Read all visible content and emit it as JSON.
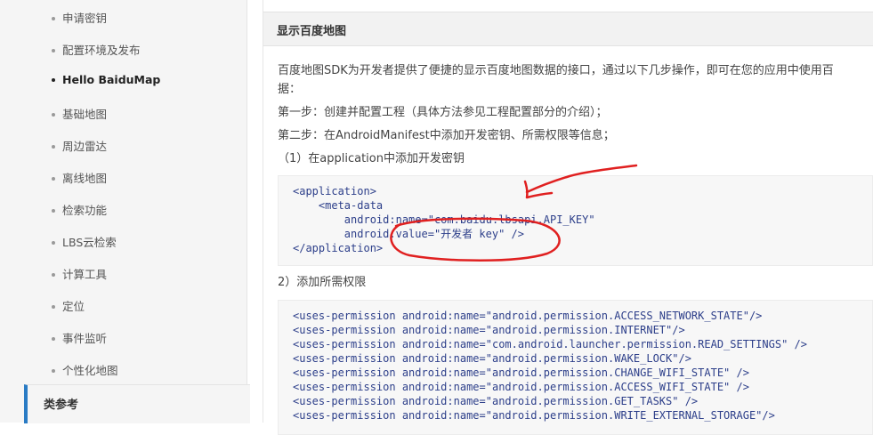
{
  "sidebar": {
    "items": [
      {
        "label": "申请密钥"
      },
      {
        "label": "配置环境及发布"
      },
      {
        "label": "Hello BaiduMap"
      },
      {
        "label": "基础地图"
      },
      {
        "label": "周边雷达"
      },
      {
        "label": "离线地图"
      },
      {
        "label": "检索功能"
      },
      {
        "label": "LBS云检索"
      },
      {
        "label": "计算工具"
      },
      {
        "label": "定位"
      },
      {
        "label": "事件监听"
      },
      {
        "label": "个性化地图"
      }
    ],
    "section": "类参考"
  },
  "main": {
    "title": "显示百度地图",
    "intro_line1": "百度地图SDK为开发者提供了便捷的显示百度地图数据的接口，通过以下几步操作，即可在您的应用中使用百",
    "intro_line2": "据：",
    "step1": "第一步：创建并配置工程（具体方法参见工程配置部分的介绍）；",
    "step2": "第二步：在AndroidManifest中添加开发密钥、所需权限等信息；",
    "step2_sub1": "（1）在application中添加开发密钥",
    "code1": [
      "<application>",
      "    <meta-data",
      "        android:name=\"com.baidu.lbsapi.API_KEY\"",
      "        android:value=\"开发者 key\" />",
      "</application>"
    ],
    "step2_sub2": "2）添加所需权限",
    "code2": [
      "<uses-permission android:name=\"android.permission.ACCESS_NETWORK_STATE\"/>",
      "<uses-permission android:name=\"android.permission.INTERNET\"/>",
      "<uses-permission android:name=\"com.android.launcher.permission.READ_SETTINGS\" />",
      "<uses-permission android:name=\"android.permission.WAKE_LOCK\"/>",
      "<uses-permission android:name=\"android.permission.CHANGE_WIFI_STATE\" />",
      "<uses-permission android:name=\"android.permission.ACCESS_WIFI_STATE\" />",
      "<uses-permission android:name=\"android.permission.GET_TASKS\" />",
      "<uses-permission android:name=\"android.permission.WRITE_EXTERNAL_STORAGE\"/>"
    ]
  },
  "colors": {
    "accent": "#2a7bc4",
    "annotation_red": "#e02020"
  }
}
